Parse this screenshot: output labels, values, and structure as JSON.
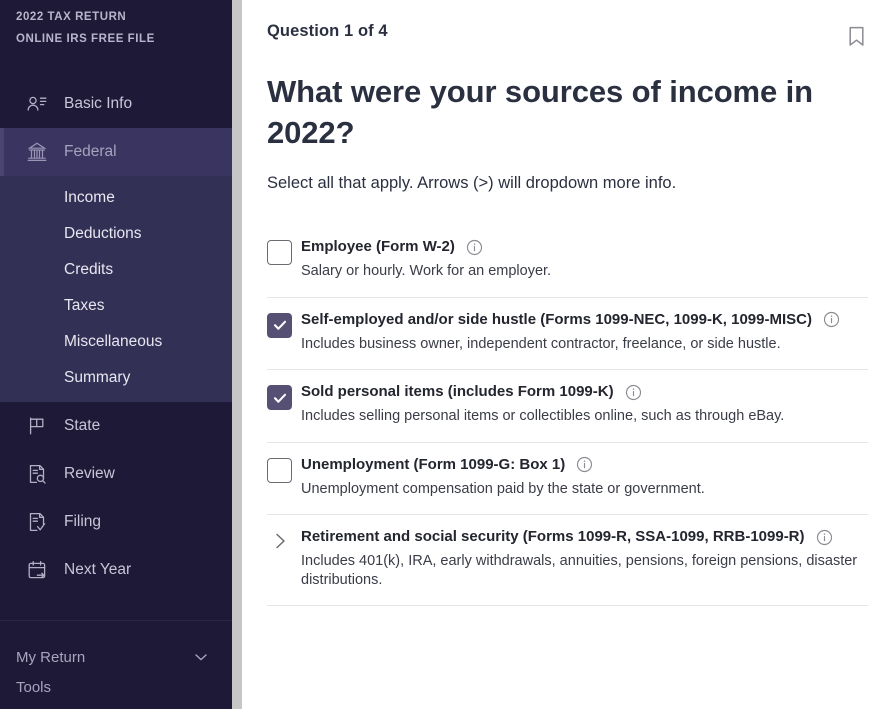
{
  "sidebar": {
    "brand_line1": "2022 TAX RETURN",
    "brand_line2": "ONLINE IRS FREE FILE",
    "nav": [
      {
        "label": "Basic Info",
        "icon": "contact-card-icon",
        "active": false
      },
      {
        "label": "Federal",
        "icon": "bank-icon",
        "active": true
      },
      {
        "label": "State",
        "icon": "flag-icon",
        "active": false
      },
      {
        "label": "Review",
        "icon": "document-search-icon",
        "active": false
      },
      {
        "label": "Filing",
        "icon": "document-check-icon",
        "active": false
      },
      {
        "label": "Next Year",
        "icon": "calendar-arrow-icon",
        "active": false
      }
    ],
    "subnav": [
      {
        "label": "Income"
      },
      {
        "label": "Deductions"
      },
      {
        "label": "Credits"
      },
      {
        "label": "Taxes"
      },
      {
        "label": "Miscellaneous"
      },
      {
        "label": "Summary"
      }
    ],
    "footer": {
      "my_return": "My Return",
      "tools": "Tools"
    }
  },
  "main": {
    "question_counter": "Question 1 of 4",
    "title": "What were your sources of income in 2022?",
    "subtitle": "Select all that apply. Arrows (>) will dropdown more info.",
    "bookmark_icon": "bookmark-icon",
    "options": [
      {
        "control": "checkbox",
        "checked": false,
        "title": "Employee (Form W-2)",
        "desc": "Salary or hourly. Work for an employer."
      },
      {
        "control": "checkbox",
        "checked": true,
        "title": "Self-employed and/or side hustle (Forms 1099-NEC, 1099-K, 1099-MISC)",
        "desc": "Includes business owner, independent contractor, freelance, or side hustle."
      },
      {
        "control": "checkbox",
        "checked": true,
        "title": "Sold personal items (includes Form 1099-K)",
        "desc": "Includes selling personal items or collectibles online, such as through eBay."
      },
      {
        "control": "checkbox",
        "checked": false,
        "title": "Unemployment (Form 1099-G: Box 1)",
        "desc": "Unemployment compensation paid by the state or government."
      },
      {
        "control": "chevron",
        "checked": false,
        "title": "Retirement and social security (Forms 1099-R, SSA-1099, RRB-1099-R)",
        "desc": "Includes 401(k), IRA, early withdrawals, annuities, pensions, foreign pensions, disaster distributions."
      }
    ]
  },
  "colors": {
    "sidebar_bg": "#1d1937",
    "subnav_bg": "#333055",
    "active_bg": "#3a3560",
    "checkbox_checked": "#565075",
    "text_dark": "#2b3041"
  }
}
